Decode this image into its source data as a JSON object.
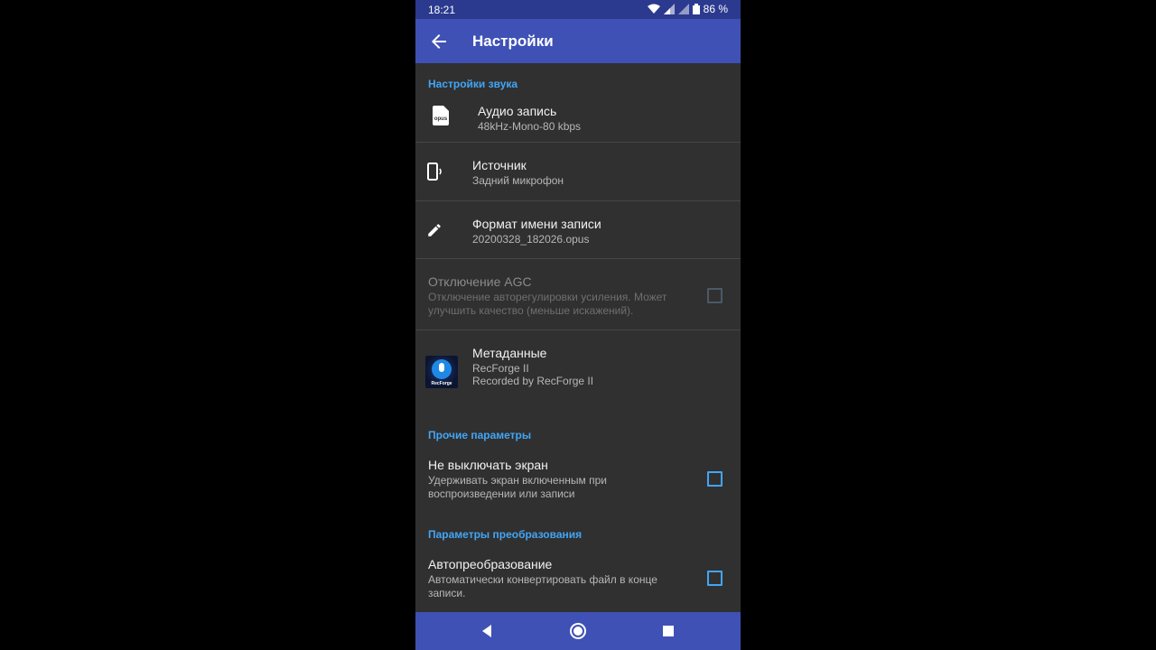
{
  "status_bar": {
    "time": "18:21",
    "battery": "86 %"
  },
  "app_bar": {
    "title": "Настройки"
  },
  "sections": {
    "sound": {
      "header": "Настройки звука",
      "audio": {
        "title": "Аудио запись",
        "sub": "48kHz-Mono-80 kbps",
        "icon_text": "opus"
      },
      "source": {
        "title": "Источник",
        "sub": "Задний микрофон"
      },
      "format": {
        "title": "Формат имени записи",
        "sub": "20200328_182026.opus"
      },
      "agc": {
        "title": "Отключение AGC",
        "sub": "Отключение авторегулировки усиления. Может улучшить качество (меньше искажений)."
      },
      "metadata": {
        "title": "Метаданные",
        "sub1": "RecForge II",
        "sub2": "Recorded by RecForge II",
        "logo_text": "RecForge"
      }
    },
    "other": {
      "header": "Прочие параметры",
      "screen": {
        "title": "Не выключать экран",
        "sub": "Удерживать экран включенным при воспроизведении или записи"
      }
    },
    "convert": {
      "header": "Параметры преобразования",
      "auto": {
        "title": "Автопреобразование",
        "sub": "Автоматически конвертировать файл в конце записи."
      }
    }
  },
  "colors": {
    "accent": "#42a5f5",
    "primary": "#3f51b5",
    "background": "#303030"
  }
}
